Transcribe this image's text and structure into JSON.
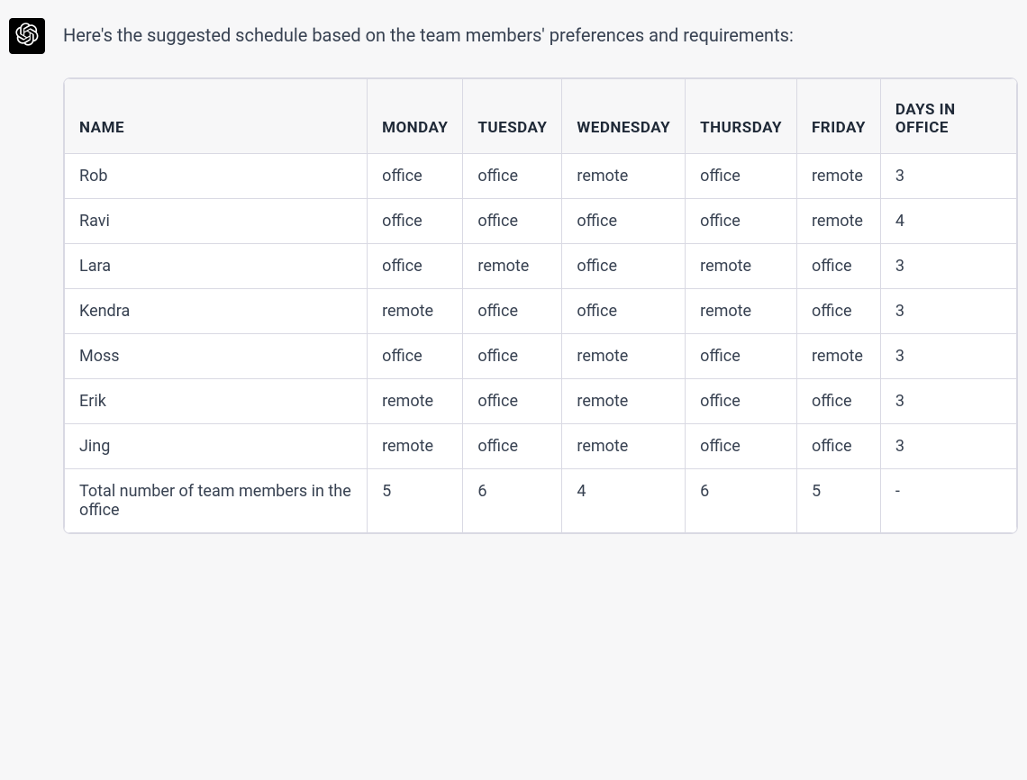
{
  "intro": "Here's the suggested schedule based on the team members' preferences and requirements:",
  "table": {
    "headers": [
      "NAME",
      "MONDAY",
      "TUESDAY",
      "WEDNESDAY",
      "THURSDAY",
      "FRIDAY",
      "DAYS IN OFFICE"
    ],
    "rows": [
      {
        "cells": [
          "Rob",
          "office",
          "office",
          "remote",
          "office",
          "remote",
          "3"
        ]
      },
      {
        "cells": [
          "Ravi",
          "office",
          "office",
          "office",
          "office",
          "remote",
          "4"
        ]
      },
      {
        "cells": [
          "Lara",
          "office",
          "remote",
          "office",
          "remote",
          "office",
          "3"
        ]
      },
      {
        "cells": [
          "Kendra",
          "remote",
          "office",
          "office",
          "remote",
          "office",
          "3"
        ]
      },
      {
        "cells": [
          "Moss",
          "office",
          "office",
          "remote",
          "office",
          "remote",
          "3"
        ]
      },
      {
        "cells": [
          "Erik",
          "remote",
          "office",
          "remote",
          "office",
          "office",
          "3"
        ]
      },
      {
        "cells": [
          "Jing",
          "remote",
          "office",
          "remote",
          "office",
          "office",
          "3"
        ]
      },
      {
        "cells": [
          "Total number of team members in the office",
          "5",
          "6",
          "4",
          "6",
          "5",
          "-"
        ]
      }
    ]
  }
}
